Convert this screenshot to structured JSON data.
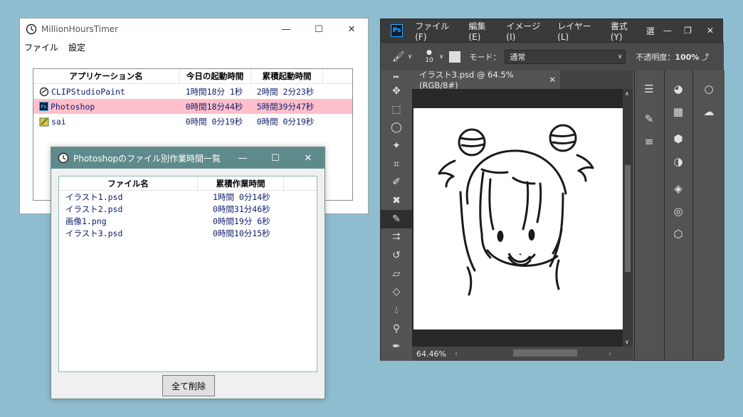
{
  "main_window": {
    "title": "MillionHoursTimer",
    "menu": [
      "ファイル",
      "設定"
    ],
    "columns": [
      "アプリケーション名",
      "今日の起動時間",
      "累積起動時間"
    ],
    "rows": [
      {
        "name": "CLIPStudioPaint",
        "today": "1時間18分 1秒",
        "total": "2時間 2分23秒",
        "icon": "clipstudio-icon"
      },
      {
        "name": "Photoshop",
        "today": "0時間18分44秒",
        "total": "5時間39分47秒",
        "icon": "photoshop-icon",
        "selected": true
      },
      {
        "name": "sai",
        "today": "0時間 0分19秒",
        "total": "0時間 0分19秒",
        "icon": "sai-icon"
      }
    ],
    "colors": {
      "selected_row": "#ffc0cb",
      "text": "#102070"
    }
  },
  "file_window": {
    "title": "Photoshopのファイル別作業時間一覧",
    "columns": [
      "ファイル名",
      "累積作業時間"
    ],
    "rows": [
      {
        "file": "イラスト1.psd",
        "time": "1時間 0分14秒"
      },
      {
        "file": "イラスト2.psd",
        "time": "0時間31分46秒"
      },
      {
        "file": "画像1.png",
        "time": "0時間19分 6秒"
      },
      {
        "file": "イラスト3.psd",
        "time": "0時間10分15秒"
      }
    ],
    "delete_all_label": "全て削除",
    "titlebar_color": "#5f8a8b"
  },
  "photoshop": {
    "logo": "Ps",
    "menu": [
      "ファイル(F)",
      "編集(E)",
      "イメージ(I)",
      "レイヤー(L)",
      "書式(Y)",
      "選"
    ],
    "brush_size": "10",
    "mode_label": "モード：",
    "mode_value": "通常",
    "opacity_label": "不透明度：",
    "opacity_value": "100%",
    "doc_tab": "イラスト3.psd @ 64.5% (RGB/8#)",
    "zoom": "64.46%"
  }
}
